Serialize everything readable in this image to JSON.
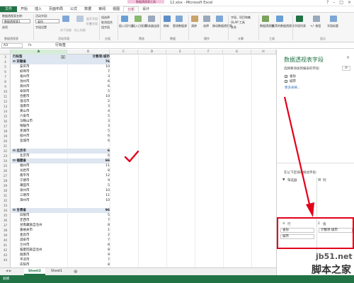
{
  "window": {
    "contextual_tab_group": "数据透视表工具",
    "title": "12.xlsx - Microsoft Excel",
    "controls": [
      "?",
      "–",
      "□",
      "×"
    ]
  },
  "tabs": [
    "文件",
    "开始",
    "插入",
    "页面布局",
    "公式",
    "数据",
    "审阅",
    "视图",
    "分析",
    "设计"
  ],
  "active_tab": "分析",
  "ribbon": {
    "pivot_name_label": "数据透视表名称:",
    "pivot_name_value": "数据透视表1",
    "options_label": "选项",
    "active_field_label": "活动字段:",
    "active_field_value": "省份",
    "field_settings_label": "字段设置",
    "drill_down_label": "向下钻取",
    "drill_up_label": "向上钻取",
    "expand_field_label": "展开字段",
    "collapse_field_label": "折叠字段",
    "group_selection_label": "组选择",
    "ungroup_label": "取消组合",
    "group_field_label": "组字段",
    "insert_slicer_label": "插入切片器",
    "insert_timeline_label": "插入日程表",
    "filter_connections_label": "筛选器连接",
    "refresh_label": "刷新",
    "change_source_label": "更改数据源",
    "clear_label": "清除",
    "select_label": "选择",
    "move_pivot_label": "移动数据透视表",
    "fields_items_sets_label": "字段、项目和集",
    "olap_tools_label": "OLAP 工具",
    "relationships_label": "关系",
    "pivotchart_label": "数据透视图",
    "recommended_label": "推荐的数据透视表",
    "field_list_label": "字段列表",
    "plus_minus_label": "+/- 按钮",
    "field_headers_label": "字段标题",
    "groups": [
      "数据透视表",
      "活动字段",
      "分组",
      "筛选",
      "数据",
      "操作",
      "计算",
      "工具",
      "显示"
    ]
  },
  "formula_bar": {
    "name_box": "A3",
    "fx_label": "fx",
    "value": "行标签"
  },
  "columns": [
    "A",
    "B",
    "C",
    "D",
    "E",
    "F",
    "G",
    "H"
  ],
  "grid": {
    "header_row_label": "行标签",
    "header_value_label": "计数项:城市",
    "rows": [
      {
        "label": "安徽省",
        "value": "76",
        "level": 0
      },
      {
        "label": "安庆市",
        "value": "10",
        "level": 1
      },
      {
        "label": "蚌埠市",
        "value": "7",
        "level": 1
      },
      {
        "label": "亳州市",
        "value": "3",
        "level": 1
      },
      {
        "label": "池州市",
        "value": "6",
        "level": 1
      },
      {
        "label": "滁州市",
        "value": "6",
        "level": 1
      },
      {
        "label": "阜阳市",
        "value": "5",
        "level": 1
      },
      {
        "label": "合肥市",
        "value": "10",
        "level": 1
      },
      {
        "label": "淮北市",
        "value": "2",
        "level": 1
      },
      {
        "label": "淮南市",
        "value": "3",
        "level": 1
      },
      {
        "label": "黄山市",
        "value": "4",
        "level": 1
      },
      {
        "label": "六安市",
        "value": "5",
        "level": 1
      },
      {
        "label": "马鞍山市",
        "value": "3",
        "level": 1
      },
      {
        "label": "铜陵市",
        "value": "3",
        "level": 1
      },
      {
        "label": "芜湖市",
        "value": "5",
        "level": 1
      },
      {
        "label": "宿州市",
        "value": "6",
        "level": 1
      },
      {
        "label": "宣城市",
        "value": "6",
        "level": 1
      },
      {
        "label": "",
        "value": "",
        "level": 1
      },
      {
        "label": "北京市",
        "value": "6",
        "level": 0
      },
      {
        "label": "北京市",
        "value": "6",
        "level": 1
      },
      {
        "label": "福建省",
        "value": "66",
        "level": 0
      },
      {
        "label": "福州市",
        "value": "11",
        "level": 1
      },
      {
        "label": "龙岩市",
        "value": "8",
        "level": 1
      },
      {
        "label": "南平市",
        "value": "12",
        "level": 1
      },
      {
        "label": "宁德市",
        "value": "9",
        "level": 1
      },
      {
        "label": "莆田市",
        "value": "5",
        "level": 1
      },
      {
        "label": "泉州市",
        "value": "10",
        "level": 1
      },
      {
        "label": "三明市",
        "value": "11",
        "level": 1
      },
      {
        "label": "漳州市",
        "value": "10",
        "level": 1
      },
      {
        "label": "",
        "value": "",
        "level": 1
      },
      {
        "label": "甘肃省",
        "value": "96",
        "level": 0
      },
      {
        "label": "白银市",
        "value": "5",
        "level": 1
      },
      {
        "label": "定西市",
        "value": "7",
        "level": 1
      },
      {
        "label": "甘南藏族自治州",
        "value": "8",
        "level": 1
      },
      {
        "label": "嘉峪关市",
        "value": "1",
        "level": 1
      },
      {
        "label": "金昌市",
        "value": "2",
        "level": 1
      },
      {
        "label": "酒泉市",
        "value": "7",
        "level": 1
      },
      {
        "label": "兰州市",
        "value": "8",
        "level": 1
      },
      {
        "label": "临夏回族自治州",
        "value": "8",
        "level": 1
      },
      {
        "label": "陇南市",
        "value": "9",
        "level": 1
      },
      {
        "label": "平凉市",
        "value": "7",
        "level": 1
      },
      {
        "label": "庆阳市",
        "value": "8",
        "level": 1
      }
    ]
  },
  "row_numbers": [
    "3",
    "4",
    "5",
    "6",
    "7",
    "8",
    "9",
    "10",
    "11",
    "12",
    "13",
    "14",
    "15",
    "16",
    "17",
    "18",
    "19",
    "20",
    "21",
    "22",
    "23",
    "24",
    "25",
    "26",
    "27",
    "28",
    "29",
    "30",
    "31",
    "32",
    "33",
    "34",
    "35",
    "36",
    "37",
    "38",
    "39",
    "40",
    "41",
    "42",
    "43",
    "44"
  ],
  "sheet_tabs": [
    "Sheet2",
    "Sheet1"
  ],
  "active_sheet": "Sheet2",
  "status": {
    "text": "就绪"
  },
  "field_panel": {
    "title": "数据透视表字段",
    "subtitle": "选择要添加到报表的字段:",
    "fields": [
      {
        "label": "省份",
        "checked": true
      },
      {
        "label": "城市",
        "checked": true
      }
    ],
    "more_tables": "更多表格...",
    "drag_hint": "在以下区域间拖动字段:",
    "filters_label": "筛选器",
    "columns_label": "列",
    "rows_label": "行",
    "values_label": "值",
    "row_fields": [
      "省份",
      "城市"
    ],
    "value_fields": [
      "计数项:城市"
    ]
  },
  "annotation": {
    "color": "#e2001a"
  },
  "watermark": {
    "line1": "jb51.net",
    "line2": "脚本之家"
  }
}
